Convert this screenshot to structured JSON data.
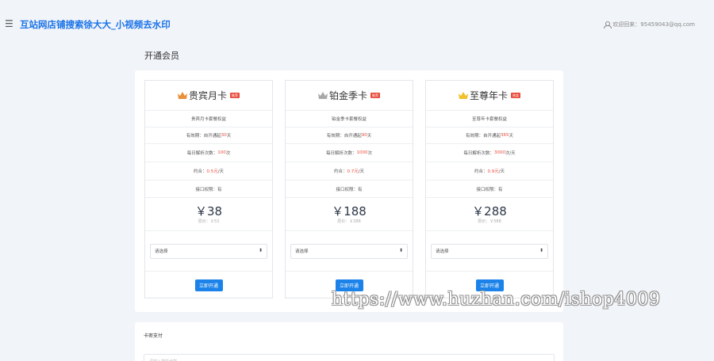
{
  "header": {
    "menu_icon": "menu-icon",
    "site_title": "互站网店铺搜索徐大大_小视频去水印",
    "user_icon": "user-icon",
    "user_text": "欢迎回来：95459043@qq.com"
  },
  "page_title": "开通会员",
  "plans": [
    {
      "name": "贵宾月卡",
      "crown_color": "#e8913a",
      "tag": "推荐",
      "desc": "贵宾月卡套餐权益",
      "validity_label": "有效期：自开通起",
      "validity_value": "30",
      "validity_unit": "天",
      "daily_label": "每日解析次数：",
      "daily_value": "100",
      "daily_unit": "次",
      "avg_label": "约合：",
      "avg_value": "0.5元",
      "avg_unit": "/天",
      "api_label": "接口权限：",
      "api_value": "有",
      "price": "￥38",
      "original": "原价：￥53",
      "select_placeholder": "请选择",
      "buy_label": "立即开通"
    },
    {
      "name": "铂金季卡",
      "crown_color": "#a9a9a9",
      "tag": "推荐",
      "desc": "铂金季卡套餐权益",
      "validity_label": "有效期：自开通起",
      "validity_value": "90",
      "validity_unit": "天",
      "daily_label": "每日解析次数：",
      "daily_value": "1000",
      "daily_unit": "次",
      "avg_label": "约合：",
      "avg_value": "0.7元",
      "avg_unit": "/天",
      "api_label": "接口权限：",
      "api_value": "有",
      "price": "￥188",
      "original": "原价：￥288",
      "select_placeholder": "请选择",
      "buy_label": "立即开通"
    },
    {
      "name": "至尊年卡",
      "crown_color": "#f2c12e",
      "tag": "热卖",
      "desc": "至尊年卡套餐权益",
      "validity_label": "有效期：自开通起",
      "validity_value": "365",
      "validity_unit": "天",
      "daily_label": "每日解析次数：",
      "daily_value": "3000",
      "daily_unit": "次/天",
      "avg_label": "约合：",
      "avg_value": "0.9元",
      "avg_unit": "/天",
      "api_label": "接口权限：",
      "api_value": "有",
      "price": "￥288",
      "original": "原价：￥588",
      "select_placeholder": "请选择",
      "buy_label": "立即开通"
    }
  ],
  "payment": {
    "title": "卡密支付",
    "input_placeholder": "请输入您的卡密"
  },
  "watermark": "https://www.huzhan.com/ishop4009",
  "colors": {
    "brand": "#1a73e8",
    "button": "#1a82e8",
    "highlight": "#e94b3c",
    "background": "#f1f4f8"
  }
}
